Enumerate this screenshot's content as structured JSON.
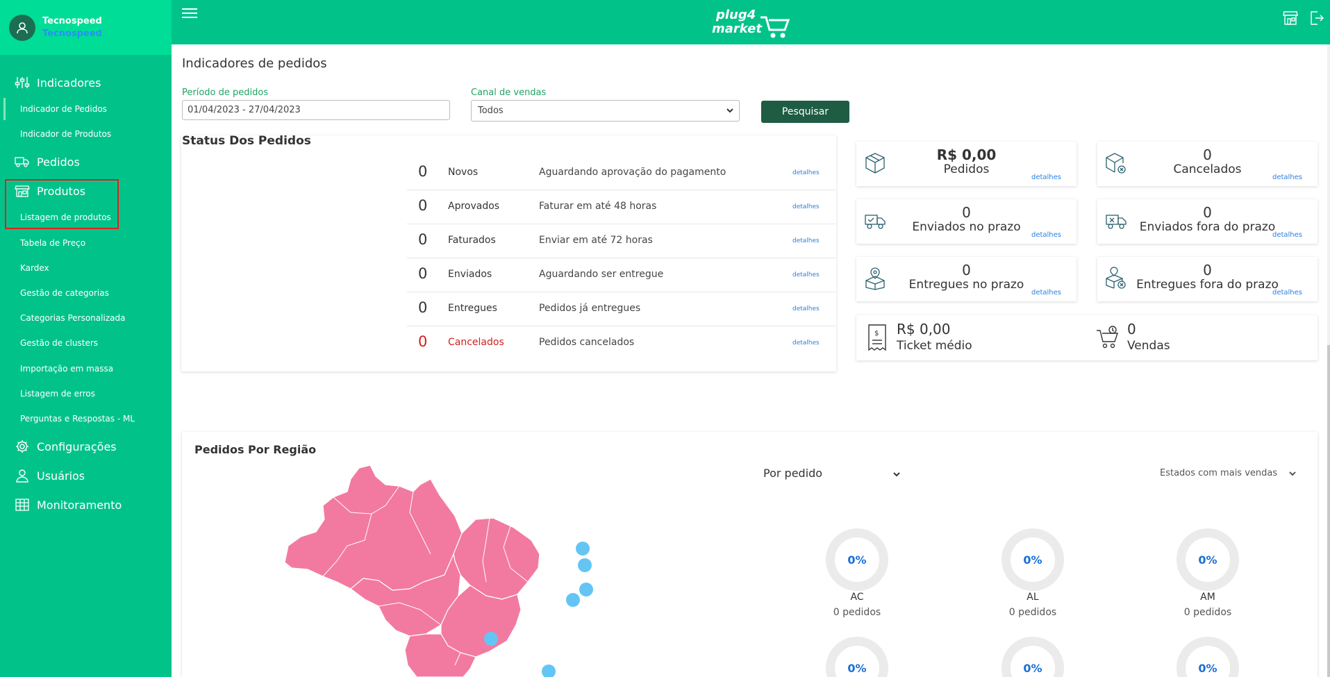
{
  "sidebar": {
    "user_name": "Tecnospeed",
    "company": "Tecnospeed",
    "items": [
      {
        "label": "Indicadores",
        "icon": "sliders-icon"
      },
      {
        "label": "Indicador de Pedidos"
      },
      {
        "label": "Indicador de Produtos"
      },
      {
        "label": "Pedidos",
        "icon": "truck-icon"
      },
      {
        "label": "Produtos",
        "icon": "store-icon"
      },
      {
        "label": "Listagem de produtos"
      },
      {
        "label": "Tabela de Preço"
      },
      {
        "label": "Kardex"
      },
      {
        "label": "Gestão de categorias"
      },
      {
        "label": "Categorias Personalizada"
      },
      {
        "label": "Gestão de clusters"
      },
      {
        "label": "Importação em massa"
      },
      {
        "label": "Listagem de erros"
      },
      {
        "label": "Perguntas e Respostas - ML"
      },
      {
        "label": "Configurações",
        "icon": "gear-icon"
      },
      {
        "label": "Usuários",
        "icon": "user-icon"
      },
      {
        "label": "Monitoramento",
        "icon": "monitor-icon"
      }
    ]
  },
  "topbar": {
    "logo_line1": "plug4",
    "logo_line2": "market"
  },
  "page": {
    "title": "Indicadores de pedidos",
    "period_label": "Período de pedidos",
    "period_value": "01/04/2023 - 27/04/2023",
    "channel_label": "Canal de vendas",
    "channel_value": "Todos",
    "search_label": "Pesquisar"
  },
  "status": {
    "title": "Status Dos Pedidos",
    "details_label": "detalhes",
    "rows": [
      {
        "count": "0",
        "name": "Novos",
        "desc": "Aguardando aprovação do pagamento"
      },
      {
        "count": "0",
        "name": "Aprovados",
        "desc": "Faturar em até 48 horas"
      },
      {
        "count": "0",
        "name": "Faturados",
        "desc": "Enviar em até 72 horas"
      },
      {
        "count": "0",
        "name": "Enviados",
        "desc": "Aguardando ser entregue"
      },
      {
        "count": "0",
        "name": "Entregues",
        "desc": "Pedidos já entregues"
      },
      {
        "count": "0",
        "name": "Cancelados",
        "desc": "Pedidos cancelados"
      }
    ]
  },
  "metrics": [
    {
      "value": "R$ 0,00",
      "label": "Pedidos",
      "icon": "box-icon"
    },
    {
      "value": "0",
      "label": "Cancelados",
      "icon": "box-cancel-icon"
    },
    {
      "value": "0",
      "label": "Enviados no prazo",
      "icon": "truck-ok-icon"
    },
    {
      "value": "0",
      "label": "Enviados fora do prazo",
      "icon": "truck-late-icon"
    },
    {
      "value": "0",
      "label": "Entregues no prazo",
      "icon": "delivered-icon"
    },
    {
      "value": "0",
      "label": "Entregues fora do prazo",
      "icon": "delivered-late-icon"
    }
  ],
  "ticket": {
    "value": "R$ 0,00",
    "label": "Ticket médio",
    "sales_value": "0",
    "sales_label": "Vendas"
  },
  "region": {
    "title": "Pedidos Por Região",
    "mode": "Por pedido",
    "sort": "Estados com mais vendas",
    "states": [
      {
        "pct": "0%",
        "state": "AC",
        "orders": "0 pedidos"
      },
      {
        "pct": "0%",
        "state": "AL",
        "orders": "0 pedidos"
      },
      {
        "pct": "0%",
        "state": "AM",
        "orders": "0 pedidos"
      },
      {
        "pct": "0%"
      },
      {
        "pct": "0%"
      },
      {
        "pct": "0%"
      }
    ]
  },
  "colors": {
    "primary": "#01c38a",
    "header": "#00dd97",
    "button": "#1e5c44",
    "map_fill": "#f27aa0",
    "marker": "#64c5f4",
    "cancel": "#d0201e",
    "link": "#2a7fdc"
  }
}
